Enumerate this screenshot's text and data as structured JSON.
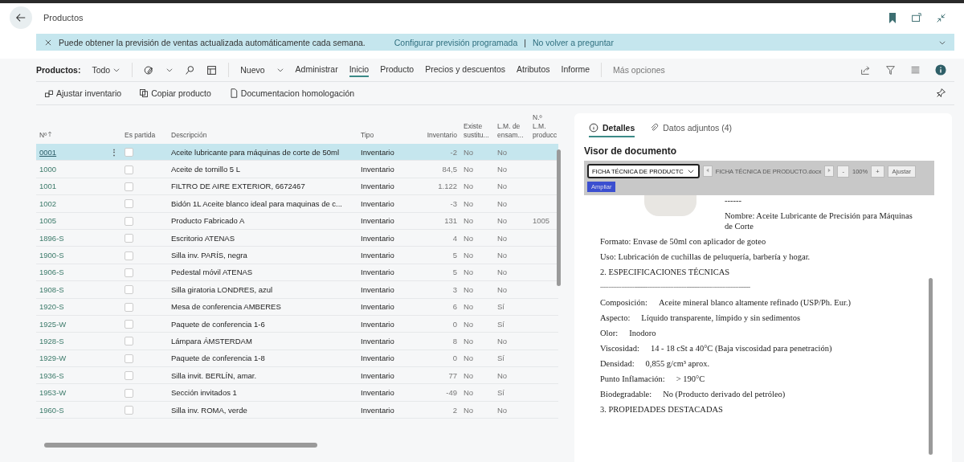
{
  "header": {
    "title": "Productos"
  },
  "banner": {
    "message": "Puede obtener la previsión de ventas actualizada automáticamente cada semana.",
    "links": [
      "Configurar previsión programada",
      "No volver a preguntar"
    ],
    "separator": "|"
  },
  "action_bar": {
    "filter_label": "Productos:",
    "filter_value": "Todo",
    "new_label": "Nuevo",
    "tabs": [
      {
        "label": "Administrar",
        "selected": false
      },
      {
        "label": "Inicio",
        "selected": true
      },
      {
        "label": "Producto",
        "selected": false
      },
      {
        "label": "Precios y descuentos",
        "selected": false
      },
      {
        "label": "Atributos",
        "selected": false
      },
      {
        "label": "Informe",
        "selected": false
      }
    ],
    "more": "Más opciones"
  },
  "sub_actions": [
    {
      "label": "Ajustar inventario",
      "kind": "adjust"
    },
    {
      "label": "Copiar producto",
      "kind": "copy"
    },
    {
      "label": "Documentacion homologación",
      "kind": "doc"
    }
  ],
  "table": {
    "columns": [
      "Nº",
      "Es partida",
      "Descripción",
      "Tipo",
      "Inventario",
      "Existe sustitu...",
      "L.M. de ensam...",
      "N.º L.M. producc"
    ],
    "row_menu": "⋮",
    "rows": [
      {
        "no": "0001",
        "partida": false,
        "desc": "Aceite lubricante para máquinas de corte de 50ml",
        "tipo": "Inventario",
        "inv": "-2",
        "existe": "No",
        "lm": "No",
        "selected": true
      },
      {
        "no": "1000",
        "partida": false,
        "desc": "Aceite de tornillo 5 L",
        "tipo": "Inventario",
        "inv": "84,5",
        "existe": "No",
        "lm": "No",
        "selected": false
      },
      {
        "no": "1001",
        "partida": false,
        "desc": "FILTRO DE AIRE EXTERIOR, 6672467",
        "tipo": "Inventario",
        "inv": "1.122",
        "existe": "No",
        "lm": "No",
        "selected": false
      },
      {
        "no": "1002",
        "partida": false,
        "desc": "Bidón 1L Aceite blanco ideal para maquinas de c...",
        "tipo": "Inventario",
        "inv": "-3",
        "existe": "No",
        "lm": "No",
        "selected": false
      },
      {
        "no": "1005",
        "partida": false,
        "desc": "Producto Fabricado A",
        "tipo": "Inventario",
        "inv": "131",
        "existe": "No",
        "lm": "No",
        "nlm": "1005",
        "selected": false
      },
      {
        "no": "1896-S",
        "partida": false,
        "desc": "Escritorio ATENAS",
        "tipo": "Inventario",
        "inv": "4",
        "existe": "No",
        "lm": "No",
        "selected": false
      },
      {
        "no": "1900-S",
        "partida": false,
        "desc": "Silla inv. PARÍS, negra",
        "tipo": "Inventario",
        "inv": "5",
        "existe": "No",
        "lm": "No",
        "selected": false
      },
      {
        "no": "1906-S",
        "partida": false,
        "desc": "Pedestal móvil ATENAS",
        "tipo": "Inventario",
        "inv": "5",
        "existe": "No",
        "lm": "No",
        "selected": false
      },
      {
        "no": "1908-S",
        "partida": false,
        "desc": "Silla giratoria LONDRES, azul",
        "tipo": "Inventario",
        "inv": "3",
        "existe": "No",
        "lm": "No",
        "selected": false
      },
      {
        "no": "1920-S",
        "partida": false,
        "desc": "Mesa de conferencia AMBERES",
        "tipo": "Inventario",
        "inv": "6",
        "existe": "No",
        "lm": "Sí",
        "selected": false
      },
      {
        "no": "1925-W",
        "partida": false,
        "desc": "Paquete de conferencia 1-6",
        "tipo": "Inventario",
        "inv": "0",
        "existe": "No",
        "lm": "Sí",
        "selected": false
      },
      {
        "no": "1928-S",
        "partida": false,
        "desc": "Lámpara ÁMSTERDAM",
        "tipo": "Inventario",
        "inv": "8",
        "existe": "No",
        "lm": "No",
        "selected": false
      },
      {
        "no": "1929-W",
        "partida": false,
        "desc": "Paquete de conferencia 1-8",
        "tipo": "Inventario",
        "inv": "0",
        "existe": "No",
        "lm": "Sí",
        "selected": false
      },
      {
        "no": "1936-S",
        "partida": false,
        "desc": "Silla invit. BERLÍN, amar.",
        "tipo": "Inventario",
        "inv": "77",
        "existe": "No",
        "lm": "No",
        "selected": false
      },
      {
        "no": "1953-W",
        "partida": false,
        "desc": "Sección invitados 1",
        "tipo": "Inventario",
        "inv": "-49",
        "existe": "No",
        "lm": "Sí",
        "selected": false
      },
      {
        "no": "1960-S",
        "partida": false,
        "desc": "Silla inv. ROMA, verde",
        "tipo": "Inventario",
        "inv": "2",
        "existe": "No",
        "lm": "No",
        "selected": false
      }
    ]
  },
  "factbox": {
    "tabs": [
      {
        "label": "Detalles",
        "selected": true,
        "kind": "info"
      },
      {
        "label": "Datos adjuntos (4)",
        "selected": false,
        "kind": "clip"
      }
    ],
    "viewer_title": "Visor de documento",
    "toolbar": {
      "file_select": "FICHA TÉCNICA DE PRODUCTC",
      "file_name": "FICHA TÉCNICA DE PRODUCTO.docx",
      "zoom_out": "-",
      "zoom": "100%",
      "zoom_in": "+",
      "fit": "Ajustar",
      "expand": "Ampliar"
    },
    "document": {
      "top_rule": "------",
      "name": "Nombre: Aceite Lubricante de Precisión para Máquinas de Corte",
      "lines": [
        "Formato: Envase de 50ml con aplicador de goteo",
        "Uso: Lubricación de cuchillas de peluquería, barbería y hogar."
      ],
      "section_2": "2. ESPECIFICACIONES TÉCNICAS",
      "rule": "--------------------------------------------------------------------------------------------",
      "specs": [
        {
          "label": "Composición:",
          "value": "Aceite mineral blanco altamente refinado (USP/Ph. Eur.)"
        },
        {
          "label": "Aspecto:",
          "value": "Líquido transparente, límpido y sin sedimentos"
        },
        {
          "label": "Olor:",
          "value": "Inodoro"
        },
        {
          "label": "Viscosidad:",
          "value": "14 - 18 cSt a 40°C (Baja viscosidad para penetración)"
        },
        {
          "label": "Densidad:",
          "value": "0,855 g/cm³ aprox."
        },
        {
          "label": "Punto Inflamación:",
          "value": "> 190°C"
        },
        {
          "label": "Biodegradable:",
          "value": "No (Producto derivado del petróleo)"
        }
      ],
      "section_3": "3. PROPIEDADES DESTACADAS"
    }
  }
}
